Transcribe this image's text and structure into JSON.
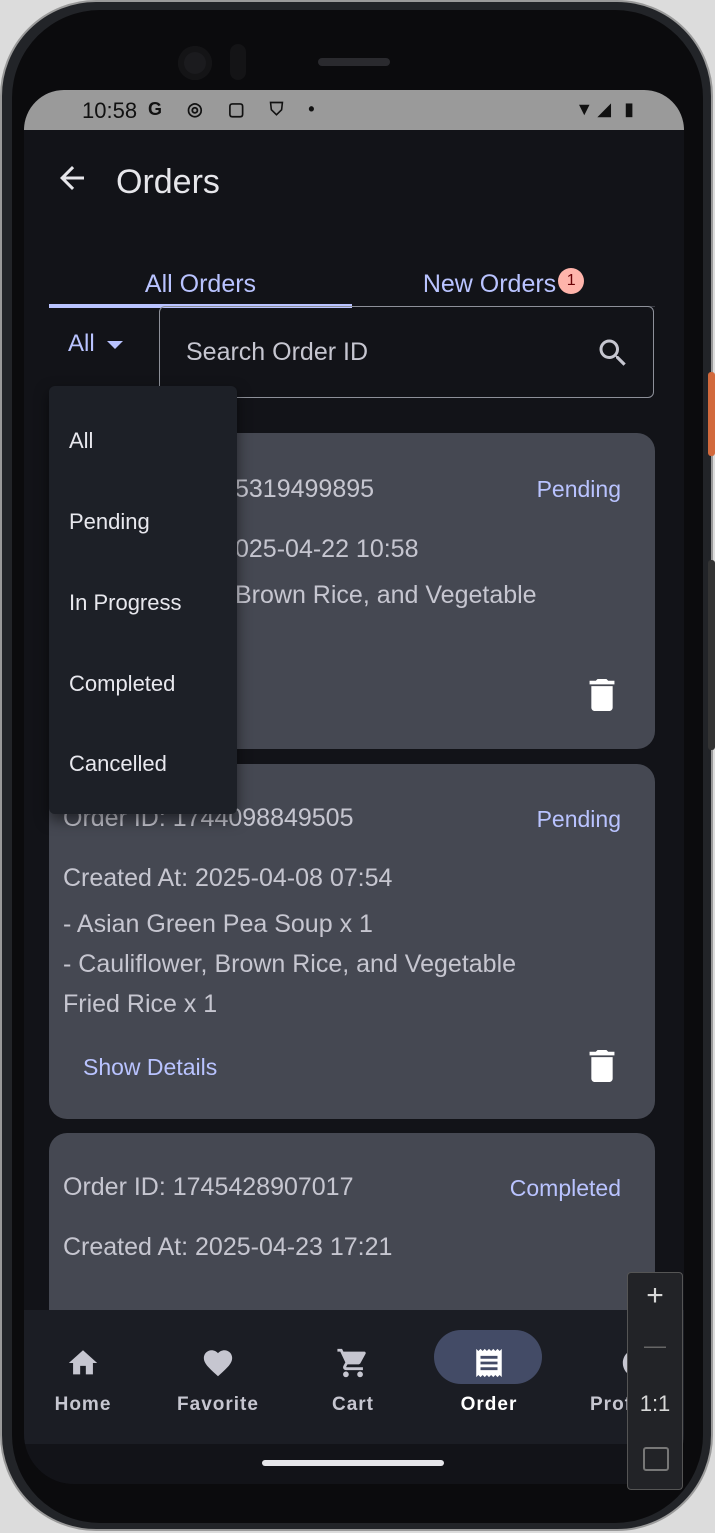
{
  "status_bar": {
    "time": "10:58",
    "left_icons": "G ◎ ▢ ⛉ •",
    "right_icons": "▼◢ ▮"
  },
  "app_bar": {
    "back_icon": "arrow-left-icon",
    "title": "Orders"
  },
  "tabs": [
    {
      "label": "All Orders",
      "selected": true
    },
    {
      "label": "New Orders",
      "badge": "1",
      "selected": false
    }
  ],
  "filter": {
    "selected": "All",
    "options": [
      "All",
      "Pending",
      "In Progress",
      "Completed",
      "Cancelled"
    ]
  },
  "search": {
    "placeholder": "Search Order ID",
    "icon": "search-icon"
  },
  "orders": [
    {
      "id_text": "5319499895",
      "status": "Pending",
      "created": "025-04-22 10:58",
      "items": [
        "Brown Rice, and Vegetable"
      ]
    },
    {
      "id_text": "Order ID: 1744098849505",
      "status": "Pending",
      "created": "Created At: 2025-04-08 07:54",
      "items": [
        "- Asian Green Pea Soup x 1",
        "- Cauliflower, Brown Rice, and Vegetable",
        "Fried Rice x 1"
      ],
      "details": "Show Details"
    },
    {
      "id_text": "Order ID: 1745428907017",
      "status": "Completed",
      "created": "Created At: 2025-04-23 17:21"
    }
  ],
  "nav": [
    {
      "label": "Home",
      "icon": "home-icon"
    },
    {
      "label": "Favorite",
      "icon": "heart-icon"
    },
    {
      "label": "Cart",
      "icon": "cart-icon"
    },
    {
      "label": "Order",
      "icon": "receipt-icon",
      "selected": true
    },
    {
      "label": "Prof",
      "icon": "profile-icon"
    }
  ],
  "zoom": {
    "plus": "+",
    "minus": "—",
    "ratio": "1:1"
  },
  "colors": {
    "accent": "#b9c3ff",
    "card": "#454852",
    "background": "#121318",
    "badge": "#ffb4ab"
  }
}
